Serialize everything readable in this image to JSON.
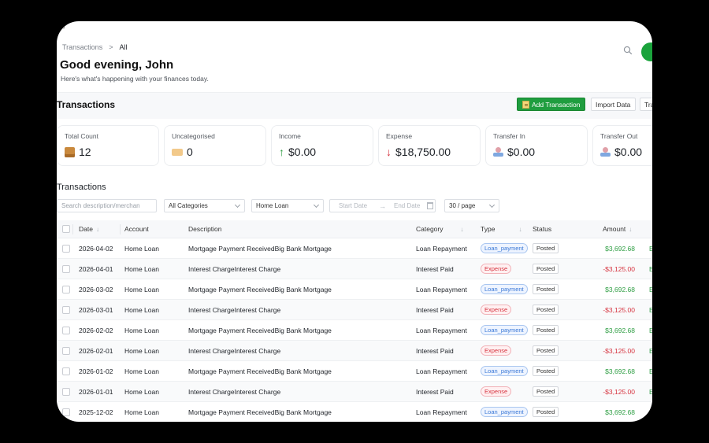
{
  "breadcrumb": {
    "root": "Transactions",
    "sep": ">",
    "current": "All"
  },
  "header": {
    "greeting": "Good evening, John",
    "subtitle": "Here's what's happening with your finances today."
  },
  "section": {
    "title": "Transactions",
    "add_label": "Add Transaction",
    "import_label": "Import Data",
    "third_label": "Tra"
  },
  "summary_cards": [
    {
      "label": "Total Count",
      "value": "12",
      "icon": "package-icon"
    },
    {
      "label": "Uncategorised",
      "value": "0",
      "icon": "tag-icon"
    },
    {
      "label": "Income",
      "value": "$0.00",
      "icon": "arrow-up-icon"
    },
    {
      "label": "Expense",
      "value": "$18,750.00",
      "icon": "arrow-down-icon"
    },
    {
      "label": "Transfer In",
      "value": "$0.00",
      "icon": "transfer-in-icon"
    },
    {
      "label": "Transfer Out",
      "value": "$0.00",
      "icon": "transfer-out-icon"
    }
  ],
  "list": {
    "title": "Transactions",
    "search_placeholder": "Search description/merchan",
    "category_filter": "All Categories",
    "account_filter": "Home Loan",
    "start_date_placeholder": "Start Date",
    "end_date_placeholder": "End Date",
    "page_size": "30 / page"
  },
  "columns": {
    "date": "Date",
    "account": "Account",
    "description": "Description",
    "category": "Category",
    "type": "Type",
    "status": "Status",
    "amount": "Amount"
  },
  "rows": [
    {
      "date": "2026-04-02",
      "account": "Home Loan",
      "description": "Mortgage Payment ReceivedBig Bank Mortgage",
      "category": "Loan Repayment",
      "type": "Loan_payment",
      "status": "Posted",
      "amount": "$3,692.68",
      "edge": "E"
    },
    {
      "date": "2026-04-01",
      "account": "Home Loan",
      "description": "Interest ChargeInterest Charge",
      "category": "Interest Paid",
      "type": "Expense",
      "status": "Posted",
      "amount": "-$3,125.00",
      "edge": "E"
    },
    {
      "date": "2026-03-02",
      "account": "Home Loan",
      "description": "Mortgage Payment ReceivedBig Bank Mortgage",
      "category": "Loan Repayment",
      "type": "Loan_payment",
      "status": "Posted",
      "amount": "$3,692.68",
      "edge": "E"
    },
    {
      "date": "2026-03-01",
      "account": "Home Loan",
      "description": "Interest ChargeInterest Charge",
      "category": "Interest Paid",
      "type": "Expense",
      "status": "Posted",
      "amount": "-$3,125.00",
      "edge": "E"
    },
    {
      "date": "2026-02-02",
      "account": "Home Loan",
      "description": "Mortgage Payment ReceivedBig Bank Mortgage",
      "category": "Loan Repayment",
      "type": "Loan_payment",
      "status": "Posted",
      "amount": "$3,692.68",
      "edge": "E"
    },
    {
      "date": "2026-02-01",
      "account": "Home Loan",
      "description": "Interest ChargeInterest Charge",
      "category": "Interest Paid",
      "type": "Expense",
      "status": "Posted",
      "amount": "-$3,125.00",
      "edge": "E"
    },
    {
      "date": "2026-01-02",
      "account": "Home Loan",
      "description": "Mortgage Payment ReceivedBig Bank Mortgage",
      "category": "Loan Repayment",
      "type": "Loan_payment",
      "status": "Posted",
      "amount": "$3,692.68",
      "edge": "E"
    },
    {
      "date": "2026-01-01",
      "account": "Home Loan",
      "description": "Interest ChargeInterest Charge",
      "category": "Interest Paid",
      "type": "Expense",
      "status": "Posted",
      "amount": "-$3,125.00",
      "edge": "E"
    },
    {
      "date": "2025-12-02",
      "account": "Home Loan",
      "description": "Mortgage Payment ReceivedBig Bank Mortgage",
      "category": "Loan Repayment",
      "type": "Loan_payment",
      "status": "Posted",
      "amount": "$3,692.68",
      "edge": "E"
    }
  ],
  "colors": {
    "accent": "#1f9d3f",
    "positive": "#2f9e44",
    "negative": "#d6333f",
    "loan_badge": "#3a78d6"
  }
}
